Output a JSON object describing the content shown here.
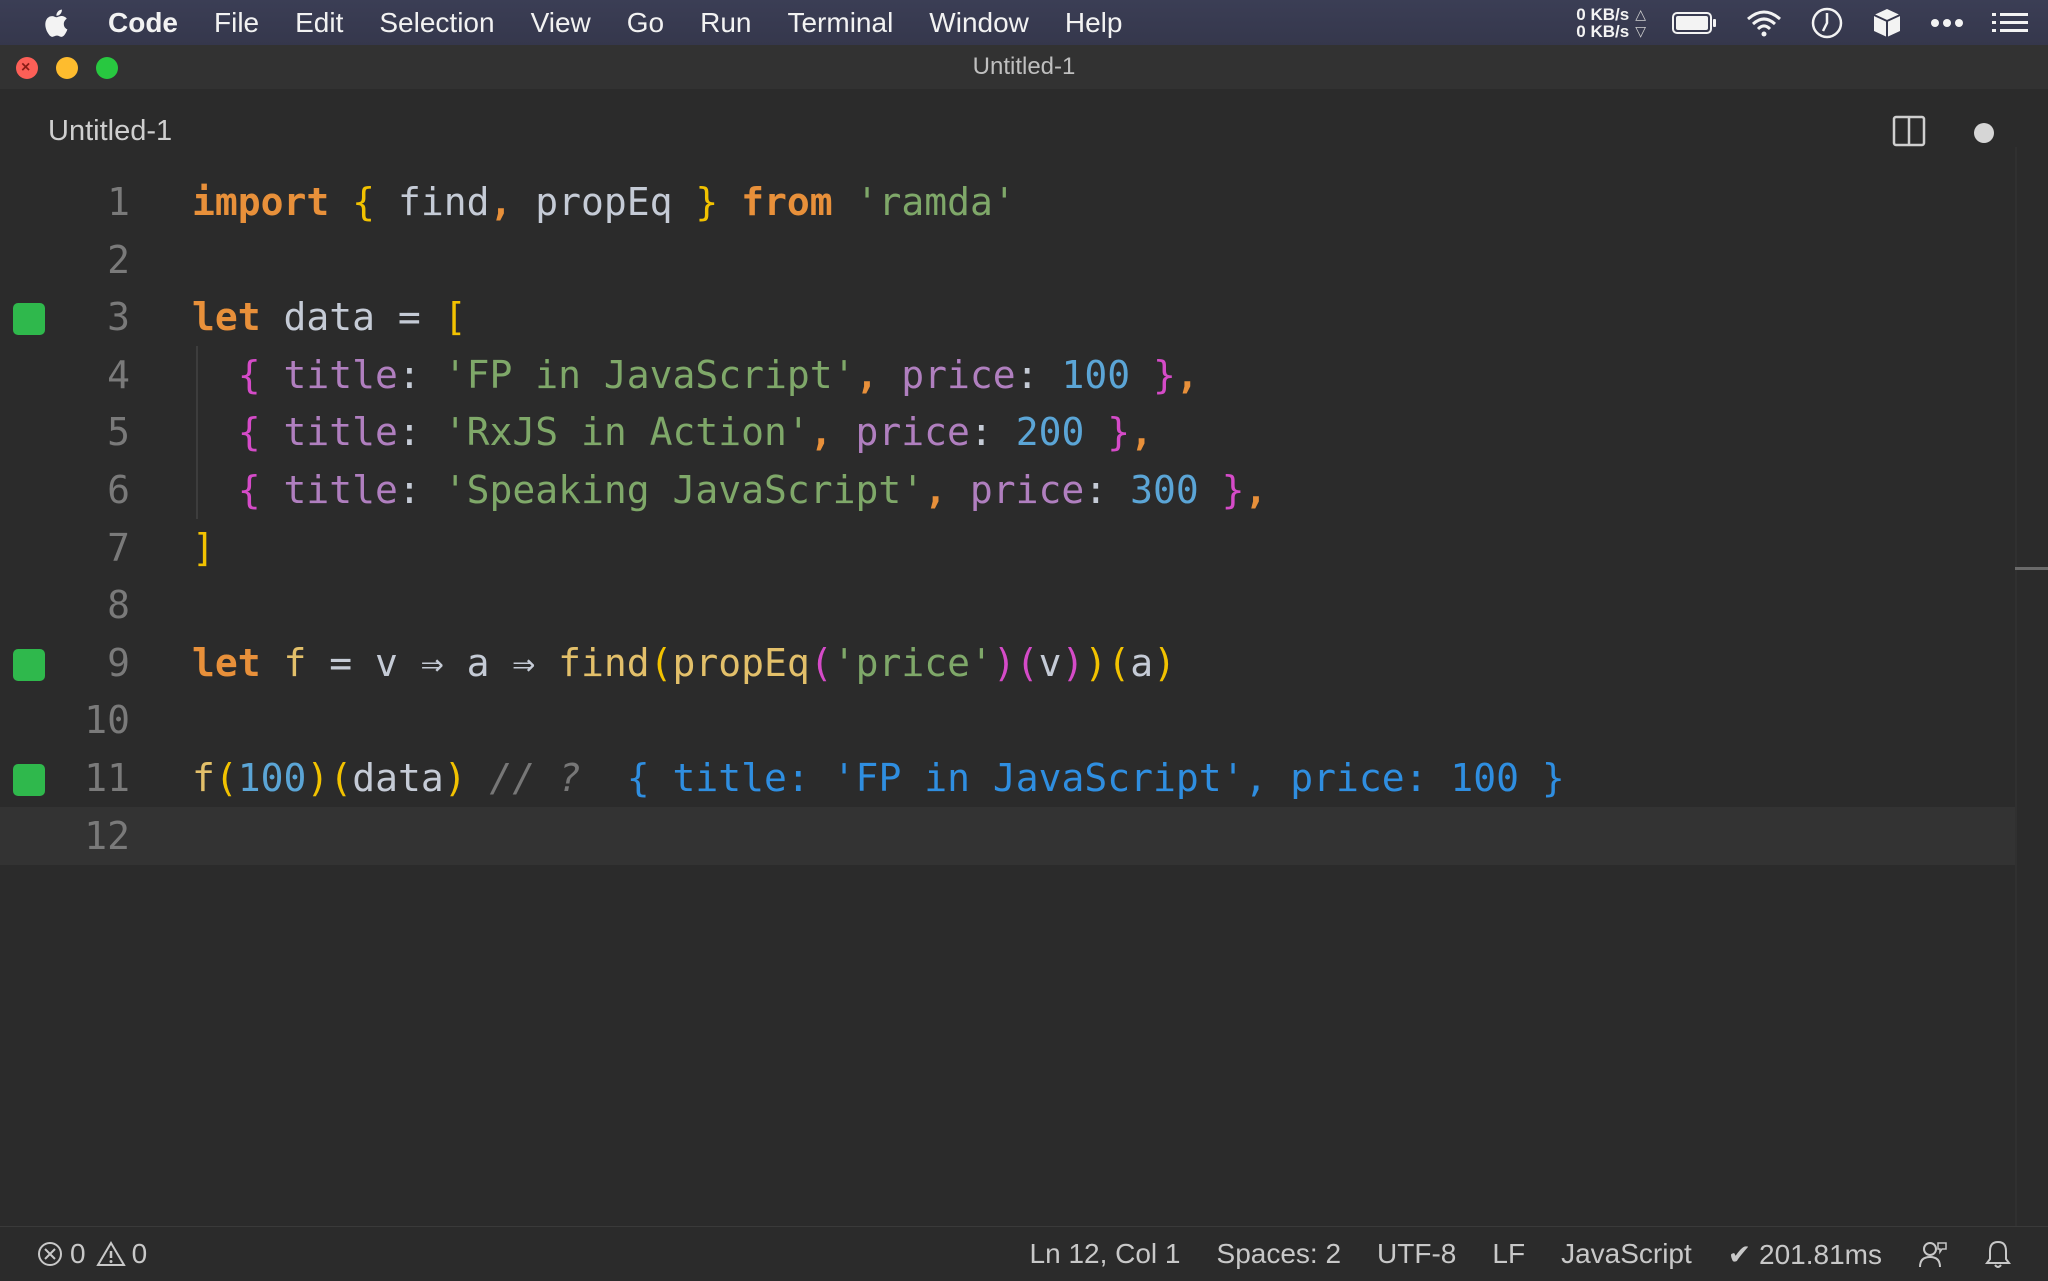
{
  "menubar": {
    "app_name": "Code",
    "items": [
      "File",
      "Edit",
      "Selection",
      "View",
      "Go",
      "Run",
      "Terminal",
      "Window",
      "Help"
    ],
    "net_up": "0 KB/s",
    "net_down": "0 KB/s",
    "net_up_arrow": "△",
    "net_down_arrow": "▽",
    "icons": [
      "apple-icon",
      "battery-icon",
      "wifi-icon",
      "clock-icon",
      "cube-icon",
      "more-icon",
      "list-icon"
    ]
  },
  "window": {
    "title": "Untitled-1",
    "close_glyph": "×",
    "controls": [
      "close",
      "minimize",
      "maximize"
    ]
  },
  "tab": {
    "label": "Untitled-1",
    "dirty": true
  },
  "editor": {
    "language": "JavaScript",
    "lines": [
      {
        "number": "1",
        "marker": false,
        "current": false,
        "tokens": [
          {
            "t": "import",
            "c": "kw"
          },
          {
            "t": " "
          },
          {
            "t": "{",
            "c": "br1"
          },
          {
            "t": " find"
          },
          {
            "t": ",",
            "c": "kw"
          },
          {
            "t": " propEq "
          },
          {
            "t": "}",
            "c": "br1"
          },
          {
            "t": " "
          },
          {
            "t": "from",
            "c": "kw"
          },
          {
            "t": " "
          },
          {
            "t": "'ramda'",
            "c": "str"
          }
        ]
      },
      {
        "number": "2",
        "marker": false,
        "current": false,
        "tokens": []
      },
      {
        "number": "3",
        "marker": true,
        "current": false,
        "tokens": [
          {
            "t": "let",
            "c": "kw"
          },
          {
            "t": " data "
          },
          {
            "t": "="
          },
          {
            "t": " "
          },
          {
            "t": "[",
            "c": "br1"
          }
        ]
      },
      {
        "number": "4",
        "marker": false,
        "current": false,
        "guide": true,
        "tokens": [
          {
            "t": "  "
          },
          {
            "t": "{",
            "c": "br2"
          },
          {
            "t": " "
          },
          {
            "t": "title",
            "c": "prop"
          },
          {
            "t": ": "
          },
          {
            "t": "'FP in JavaScript'",
            "c": "str"
          },
          {
            "t": ",",
            "c": "kw"
          },
          {
            "t": " "
          },
          {
            "t": "price",
            "c": "prop"
          },
          {
            "t": ": "
          },
          {
            "t": "100",
            "c": "num"
          },
          {
            "t": " "
          },
          {
            "t": "}",
            "c": "br2"
          },
          {
            "t": ",",
            "c": "kw"
          }
        ]
      },
      {
        "number": "5",
        "marker": false,
        "current": false,
        "guide": true,
        "tokens": [
          {
            "t": "  "
          },
          {
            "t": "{",
            "c": "br2"
          },
          {
            "t": " "
          },
          {
            "t": "title",
            "c": "prop"
          },
          {
            "t": ": "
          },
          {
            "t": "'RxJS in Action'",
            "c": "str"
          },
          {
            "t": ",",
            "c": "kw"
          },
          {
            "t": " "
          },
          {
            "t": "price",
            "c": "prop"
          },
          {
            "t": ": "
          },
          {
            "t": "200",
            "c": "num"
          },
          {
            "t": " "
          },
          {
            "t": "}",
            "c": "br2"
          },
          {
            "t": ",",
            "c": "kw"
          }
        ]
      },
      {
        "number": "6",
        "marker": false,
        "current": false,
        "guide": true,
        "tokens": [
          {
            "t": "  "
          },
          {
            "t": "{",
            "c": "br2"
          },
          {
            "t": " "
          },
          {
            "t": "title",
            "c": "prop"
          },
          {
            "t": ": "
          },
          {
            "t": "'Speaking JavaScript'",
            "c": "str"
          },
          {
            "t": ",",
            "c": "kw"
          },
          {
            "t": " "
          },
          {
            "t": "price",
            "c": "prop"
          },
          {
            "t": ": "
          },
          {
            "t": "300",
            "c": "num"
          },
          {
            "t": " "
          },
          {
            "t": "}",
            "c": "br2"
          },
          {
            "t": ",",
            "c": "kw"
          }
        ]
      },
      {
        "number": "7",
        "marker": false,
        "current": false,
        "tokens": [
          {
            "t": "]",
            "c": "br1"
          }
        ]
      },
      {
        "number": "8",
        "marker": false,
        "current": false,
        "tokens": []
      },
      {
        "number": "9",
        "marker": true,
        "current": false,
        "tokens": [
          {
            "t": "let",
            "c": "kw"
          },
          {
            "t": " "
          },
          {
            "t": "f",
            "c": "fn"
          },
          {
            "t": " = v "
          },
          {
            "t": "⇒",
            "c": "op"
          },
          {
            "t": " a "
          },
          {
            "t": "⇒",
            "c": "op"
          },
          {
            "t": " "
          },
          {
            "t": "find",
            "c": "fn"
          },
          {
            "t": "(",
            "c": "br1"
          },
          {
            "t": "propEq",
            "c": "fn"
          },
          {
            "t": "(",
            "c": "br2"
          },
          {
            "t": "'price'",
            "c": "str"
          },
          {
            "t": ")",
            "c": "br2"
          },
          {
            "t": "(",
            "c": "br2"
          },
          {
            "t": "v"
          },
          {
            "t": ")",
            "c": "br2"
          },
          {
            "t": ")",
            "c": "br1"
          },
          {
            "t": "(",
            "c": "br1"
          },
          {
            "t": "a"
          },
          {
            "t": ")",
            "c": "br1"
          }
        ]
      },
      {
        "number": "10",
        "marker": false,
        "current": false,
        "tokens": []
      },
      {
        "number": "11",
        "marker": true,
        "current": false,
        "tokens": [
          {
            "t": "f",
            "c": "fn"
          },
          {
            "t": "(",
            "c": "br1"
          },
          {
            "t": "100",
            "c": "num"
          },
          {
            "t": ")",
            "c": "br1"
          },
          {
            "t": "(",
            "c": "br1"
          },
          {
            "t": "data"
          },
          {
            "t": ")",
            "c": "br1"
          },
          {
            "t": " "
          },
          {
            "t": "// ?",
            "c": "comment"
          },
          {
            "t": "  "
          },
          {
            "t": "{ title: 'FP in JavaScript', price: 100 }",
            "c": "result"
          }
        ]
      },
      {
        "number": "12",
        "marker": false,
        "current": true,
        "tokens": []
      }
    ]
  },
  "statusbar": {
    "errors": "0",
    "warnings": "0",
    "position": "Ln 12, Col 1",
    "spaces": "Spaces: 2",
    "encoding": "UTF-8",
    "eol": "LF",
    "language": "JavaScript",
    "timing": "✔ 201.81ms"
  }
}
